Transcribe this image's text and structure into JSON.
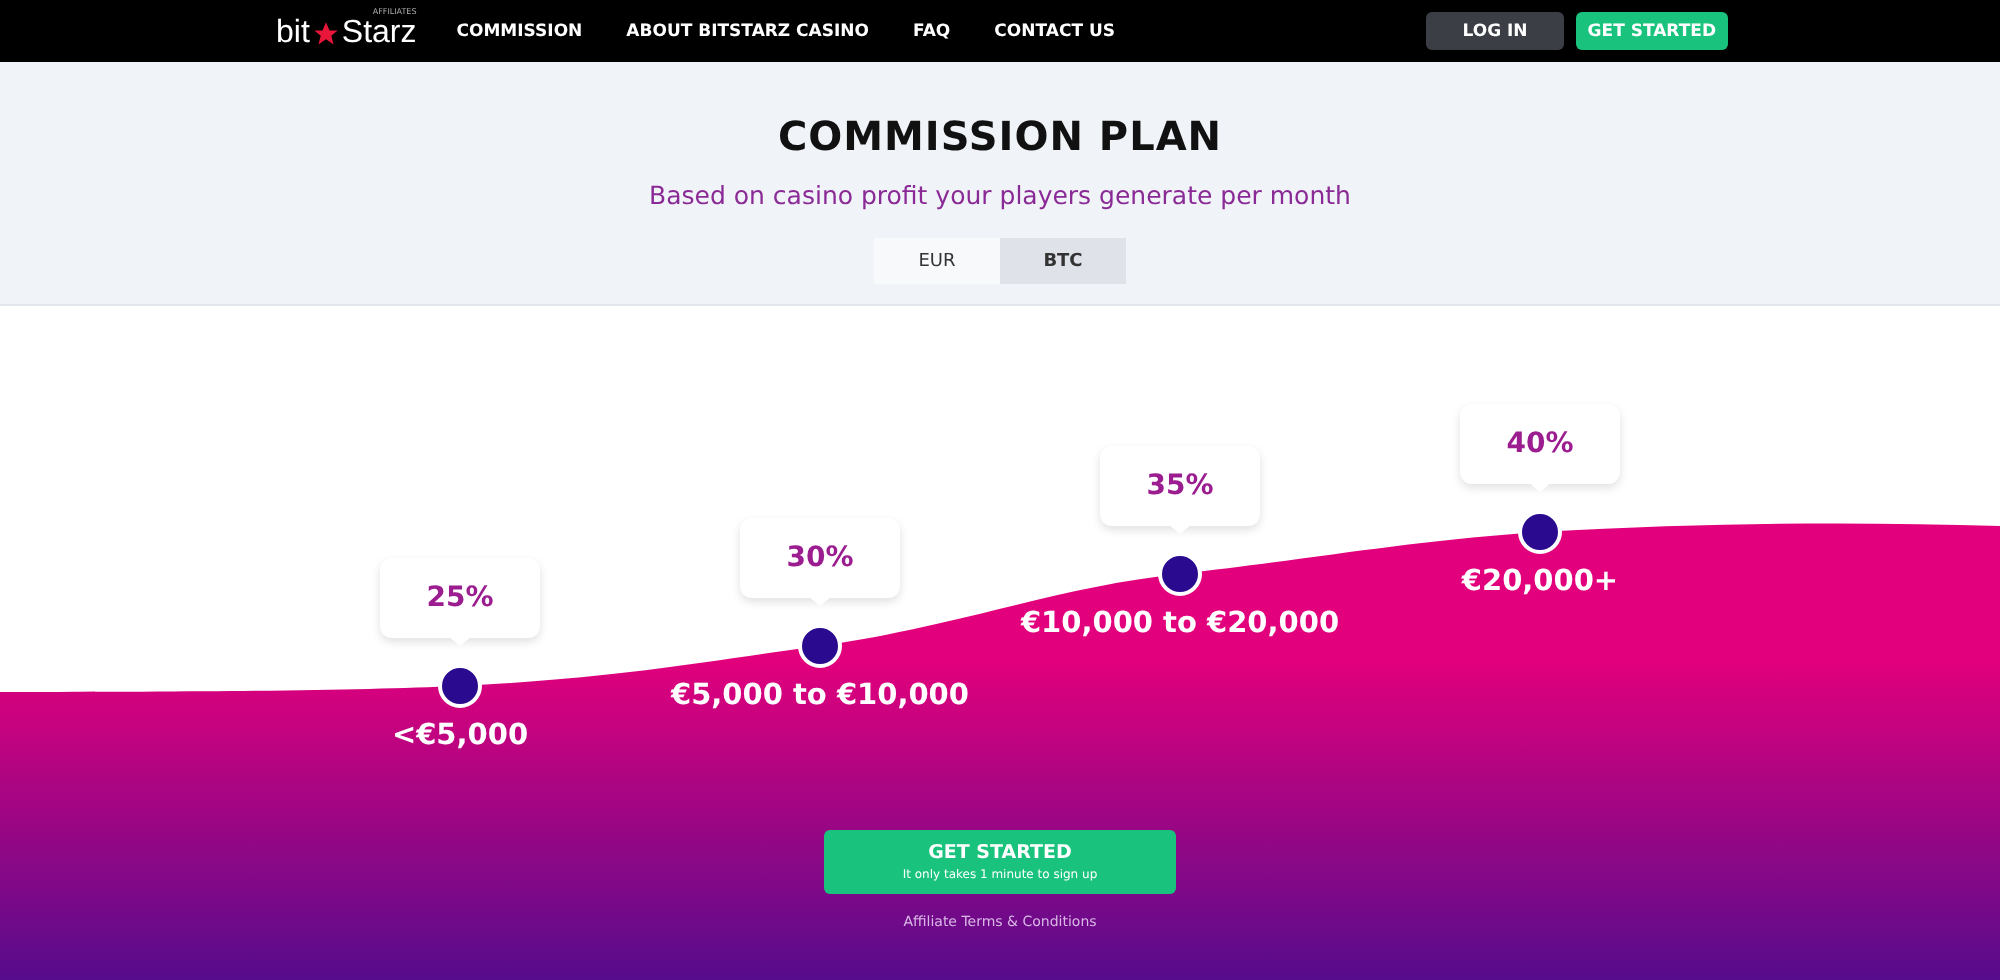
{
  "nav": {
    "logo": {
      "word_1": "bit",
      "word_2": "Starz",
      "tag": "AFFILIATES"
    },
    "links": [
      "COMMISSION",
      "ABOUT BITSTARZ CASINO",
      "FAQ",
      "CONTACT US"
    ],
    "login": "LOG IN",
    "get_started": "GET STARTED"
  },
  "hero": {
    "title": "COMMISSION PLAN",
    "subtitle": "Based on casino profit your players generate per month"
  },
  "tabs": [
    {
      "label": "EUR",
      "selected": true
    },
    {
      "label": "BTC",
      "selected": false
    }
  ],
  "tiers": [
    {
      "percent": "25%",
      "range": "<€5,000"
    },
    {
      "percent": "30%",
      "range": "€5,000 to €10,000"
    },
    {
      "percent": "35%",
      "range": "€10,000 to €20,000"
    },
    {
      "percent": "40%",
      "range": "€20,000+"
    }
  ],
  "cta": {
    "label": "GET STARTED",
    "sublabel": "It only takes 1 minute to sign up"
  },
  "terms_link": "Affiliate Terms & Conditions"
}
